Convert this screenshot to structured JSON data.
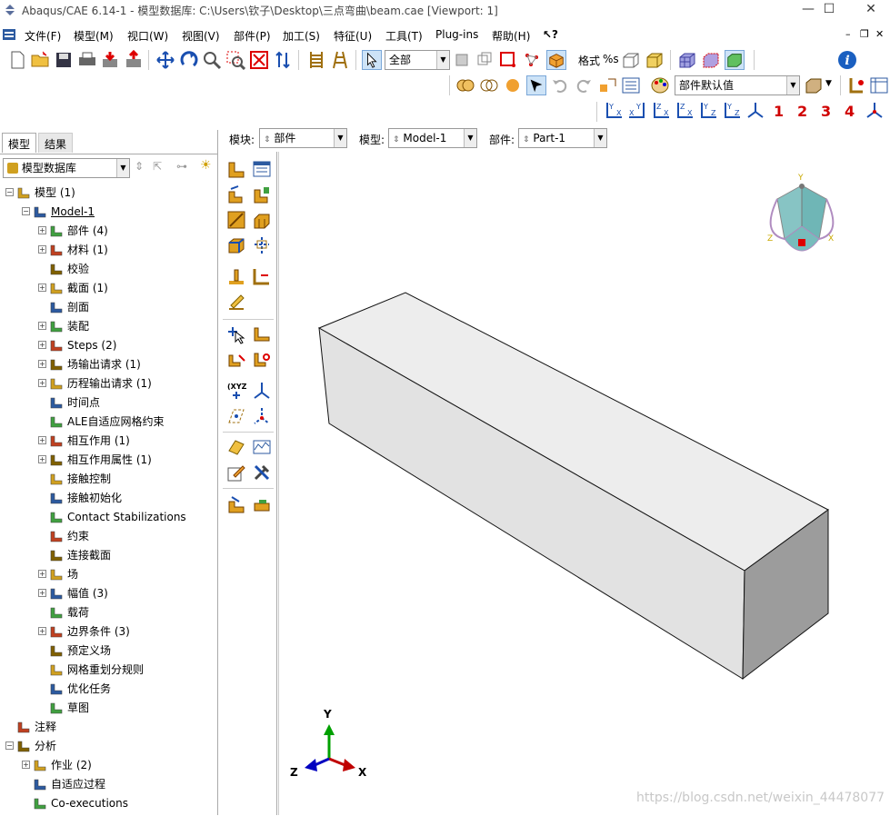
{
  "window": {
    "title": "Abaqus/CAE 6.14-1 - 模型数据库: C:\\Users\\钦子\\Desktop\\三点弯曲\\beam.cae [Viewport: 1]",
    "minimize": "—",
    "maximize": "☐",
    "close": "✕"
  },
  "menu": {
    "items": [
      "文件(F)",
      "模型(M)",
      "视口(W)",
      "视图(V)",
      "部件(P)",
      "加工(S)",
      "特征(U)",
      "工具(T)",
      "Plug-ins",
      "帮助(H)",
      "↖?"
    ]
  },
  "toolbar": {
    "selection_filter": "全部",
    "style_label": "格式",
    "style_percent": "%s",
    "part_defaults": "部件默认值",
    "csys_numbers": [
      "1",
      "2",
      "3",
      "4"
    ]
  },
  "context": {
    "module_label": "模块:",
    "module_value": "部件",
    "model_label": "模型:",
    "model_value": "Model-1",
    "part_label": "部件:",
    "part_value": "Part-1"
  },
  "tree": {
    "tabs": [
      "模型",
      "结果"
    ],
    "database_combo": "模型数据库",
    "rows": [
      {
        "label": "模型 (1)",
        "level": 0,
        "expander": "-"
      },
      {
        "label": "Model-1",
        "level": 1,
        "expander": "-"
      },
      {
        "label": "部件 (4)",
        "level": 2,
        "expander": "+"
      },
      {
        "label": "材料 (1)",
        "level": 2,
        "expander": "+"
      },
      {
        "label": "校验",
        "level": 2,
        "expander": ""
      },
      {
        "label": "截面 (1)",
        "level": 2,
        "expander": "+"
      },
      {
        "label": "剖面",
        "level": 2,
        "expander": ""
      },
      {
        "label": "装配",
        "level": 2,
        "expander": "+"
      },
      {
        "label": "Steps (2)",
        "level": 2,
        "expander": "+"
      },
      {
        "label": "场输出请求 (1)",
        "level": 2,
        "expander": "+"
      },
      {
        "label": "历程输出请求 (1)",
        "level": 2,
        "expander": "+"
      },
      {
        "label": "时间点",
        "level": 2,
        "expander": ""
      },
      {
        "label": "ALE自适应网格约束",
        "level": 2,
        "expander": ""
      },
      {
        "label": "相互作用  (1)",
        "level": 2,
        "expander": "+"
      },
      {
        "label": "相互作用属性 (1)",
        "level": 2,
        "expander": "+"
      },
      {
        "label": "接触控制",
        "level": 2,
        "expander": ""
      },
      {
        "label": "接触初始化",
        "level": 2,
        "expander": ""
      },
      {
        "label": "Contact Stabilizations",
        "level": 2,
        "expander": ""
      },
      {
        "label": "约束",
        "level": 2,
        "expander": ""
      },
      {
        "label": "连接截面",
        "level": 2,
        "expander": ""
      },
      {
        "label": "场",
        "level": 2,
        "expander": "+"
      },
      {
        "label": "幅值 (3)",
        "level": 2,
        "expander": "+"
      },
      {
        "label": "载荷",
        "level": 2,
        "expander": ""
      },
      {
        "label": "边界条件 (3)",
        "level": 2,
        "expander": "+"
      },
      {
        "label": "预定义场",
        "level": 2,
        "expander": ""
      },
      {
        "label": "网格重划分规则",
        "level": 2,
        "expander": ""
      },
      {
        "label": "优化任务",
        "level": 2,
        "expander": ""
      },
      {
        "label": "草图",
        "level": 2,
        "expander": ""
      },
      {
        "label": "注释",
        "level": 0,
        "expander": ""
      },
      {
        "label": "分析",
        "level": 0,
        "expander": "-"
      },
      {
        "label": "作业 (2)",
        "level": 1,
        "expander": "+"
      },
      {
        "label": "自适应过程",
        "level": 1,
        "expander": ""
      },
      {
        "label": "Co-executions",
        "level": 1,
        "expander": ""
      }
    ]
  },
  "triad": {
    "x": "X",
    "y": "Y",
    "z": "Z"
  },
  "view_cube": {
    "x": "X",
    "y": "Y",
    "z": "Z"
  },
  "watermark": "https://blog.csdn.net/weixin_44478077",
  "colors": {
    "beam_front": "#e6e6e6",
    "beam_top": "#ededed",
    "beam_end": "#9a9a9a",
    "axis_x": "#c00000",
    "axis_y": "#00a000",
    "axis_z": "#0000c0"
  }
}
